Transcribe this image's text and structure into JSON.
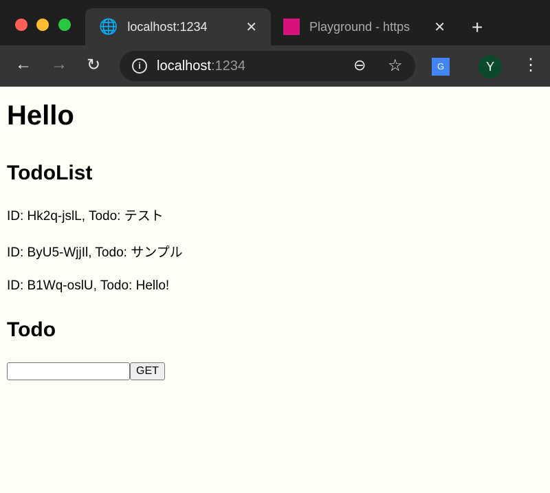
{
  "browser": {
    "tabs": [
      {
        "title": "localhost:1234",
        "icon": "globe-icon",
        "active": true
      },
      {
        "title": "Playground - https",
        "icon": "graphql-icon",
        "active": false
      }
    ],
    "url_host": "localhost",
    "url_port": ":1234",
    "profile_initial": "Y",
    "colors": {
      "close": "#fe5f57",
      "minimize": "#febc2e",
      "maximize": "#28c840",
      "graphql": "#d9127a",
      "avatar": "#0d4a2c"
    }
  },
  "page": {
    "title": "Hello",
    "list_heading": "TodoList",
    "todos": [
      "ID: Hk2q-jslL, Todo: テスト",
      "ID: ByU5-WjjIl, Todo: サンプル",
      "ID: B1Wq-oslU, Todo: Hello!"
    ],
    "form_heading": "Todo",
    "input_value": "",
    "get_label": "GET"
  }
}
